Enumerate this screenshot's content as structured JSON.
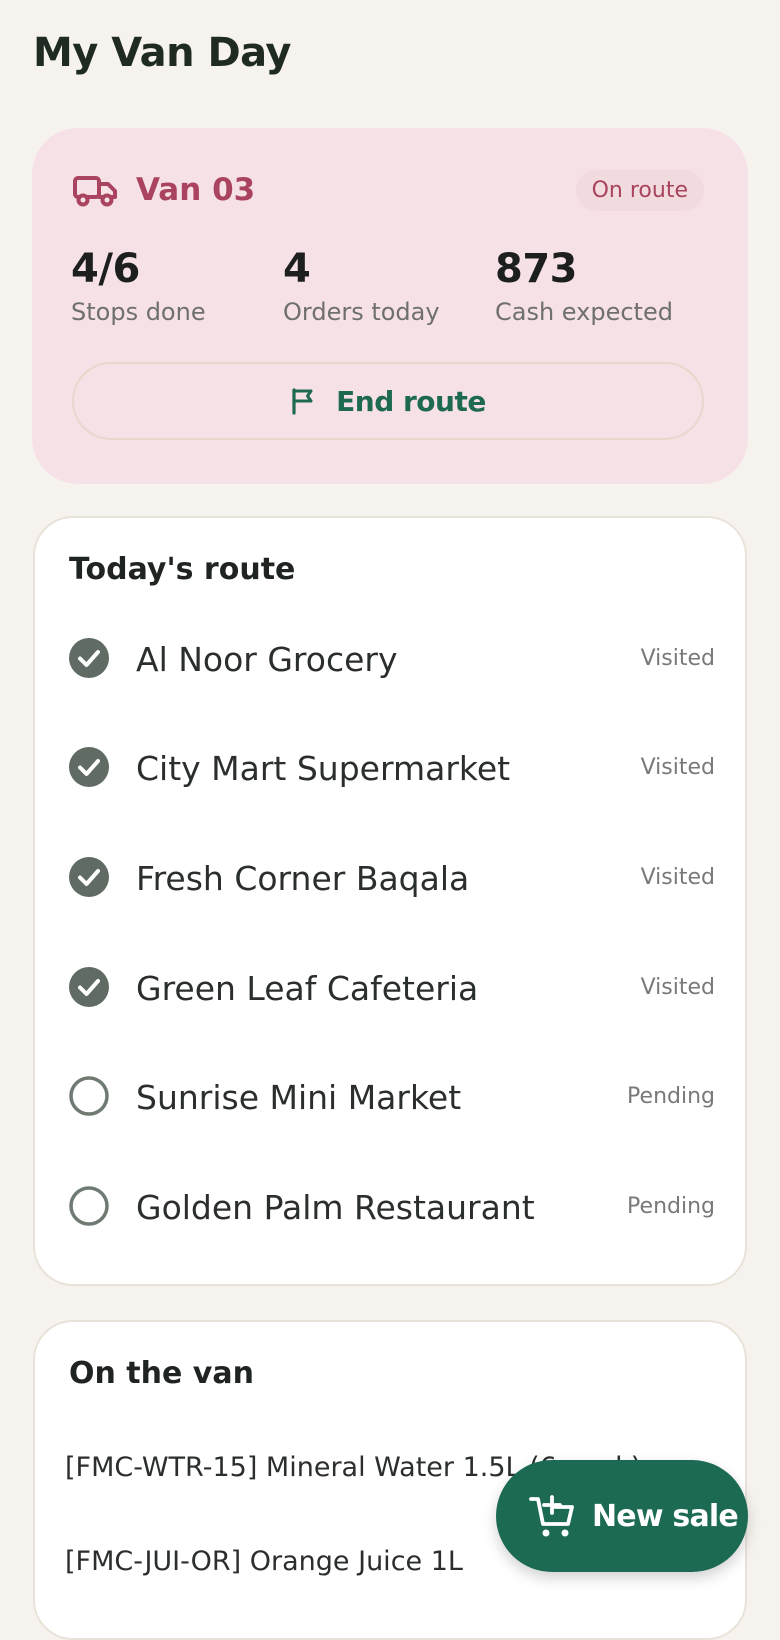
{
  "header": {
    "title": "My Van Day"
  },
  "van": {
    "name": "Van 03",
    "status": "On route",
    "icon": "truck-icon",
    "stats": [
      {
        "value": "4/6",
        "label": "Stops done"
      },
      {
        "value": "4",
        "label": "Orders today"
      },
      {
        "value": "873",
        "label": "Cash expected"
      }
    ],
    "end_route_label": "End route",
    "end_route_icon": "flag-icon"
  },
  "route": {
    "title": "Today's route",
    "stops": [
      {
        "name": "Al Noor Grocery",
        "status": "Visited",
        "done": true
      },
      {
        "name": "City Mart Supermarket",
        "status": "Visited",
        "done": true
      },
      {
        "name": "Fresh Corner Baqala",
        "status": "Visited",
        "done": true
      },
      {
        "name": "Green Leaf Cafeteria",
        "status": "Visited",
        "done": true
      },
      {
        "name": "Sunrise Mini Market",
        "status": "Pending",
        "done": false
      },
      {
        "name": "Golden Palm Restaurant",
        "status": "Pending",
        "done": false
      }
    ]
  },
  "stock": {
    "title": "On the van",
    "items": [
      {
        "label": "[FMC-WTR-15] Mineral Water 1.5L (6-pack)",
        "qty": ""
      },
      {
        "label": "[FMC-JUI-OR] Orange Juice 1L",
        "qty": ""
      }
    ]
  },
  "fab": {
    "label": "New sale",
    "icon": "cart-plus-icon"
  },
  "colors": {
    "accent": "#1d6a54",
    "van_accent": "#a9435f",
    "van_card_bg": "#f6e1e6",
    "page_bg": "#f6f3ee",
    "check_done": "#5f6b63"
  }
}
